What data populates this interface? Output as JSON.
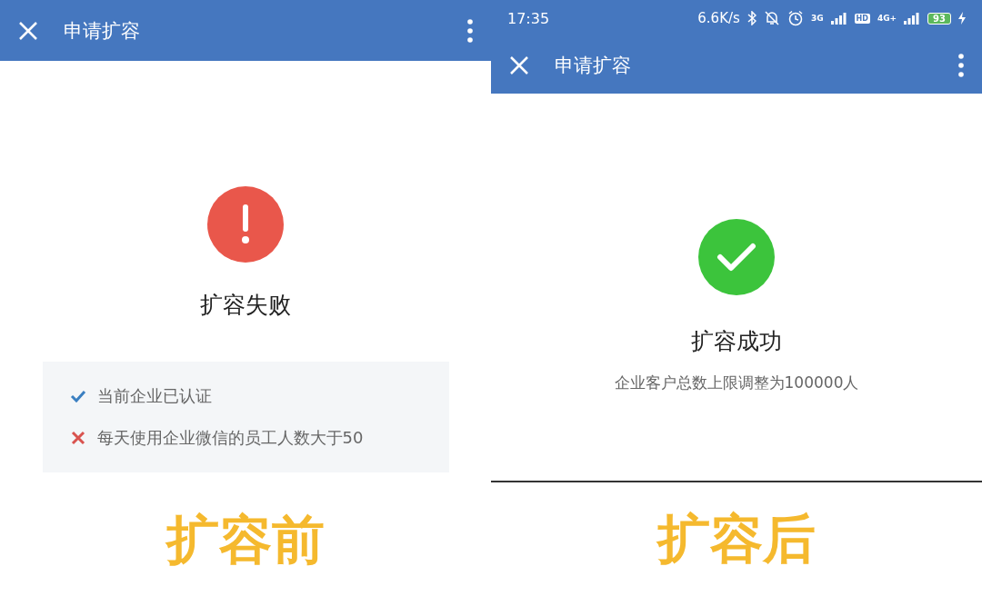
{
  "panels": [
    {
      "header": {
        "title": "申请扩容"
      },
      "result": {
        "kind": "fail",
        "title": "扩容失败"
      },
      "requirements": [
        {
          "text": "当前企业已认证",
          "met": true
        },
        {
          "text": "每天使用企业微信的员工人数大于50",
          "met": false
        }
      ],
      "caption": "扩容前"
    },
    {
      "status_bar": {
        "time": "17:35",
        "speed": "6.6K/s",
        "network_1": "3G",
        "hd": "HD",
        "network_2": "4G+",
        "battery": "93"
      },
      "header": {
        "title": "申请扩容"
      },
      "result": {
        "kind": "success",
        "title": "扩容成功",
        "message": "企业客户总数上限调整为100000人"
      },
      "caption": "扩容后"
    }
  ]
}
